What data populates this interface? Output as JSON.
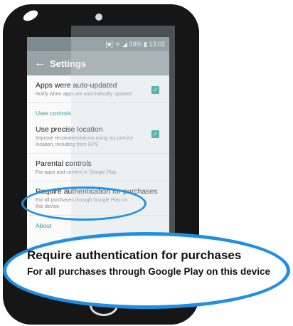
{
  "status_bar": {
    "text": "[■] ᯤ ◢ 58% ▮ 13:02"
  },
  "app_bar": {
    "title": "Settings"
  },
  "items": [
    {
      "title": "Apps were auto-updated",
      "subtitle": "Notify when apps are automatically updated",
      "checked": true
    },
    {
      "title": "Use precise location",
      "subtitle": "Improve recommendations using my precise location, including from GPS",
      "checked": true
    },
    {
      "title": "Parental controls",
      "subtitle": "For apps and content in Google Play"
    },
    {
      "title": "Require authentication for purchases",
      "subtitle": "For all purchases through Google Play on this device"
    }
  ],
  "sections": {
    "user_controls": "User controls",
    "about": "About"
  },
  "callout": {
    "title": "Require authentication for purchases",
    "subtitle": "For all purchases through Google Play on this device"
  },
  "colors": {
    "accent": "#2e9b92",
    "highlight": "#1f8fe6",
    "phone_body": "#161616"
  }
}
